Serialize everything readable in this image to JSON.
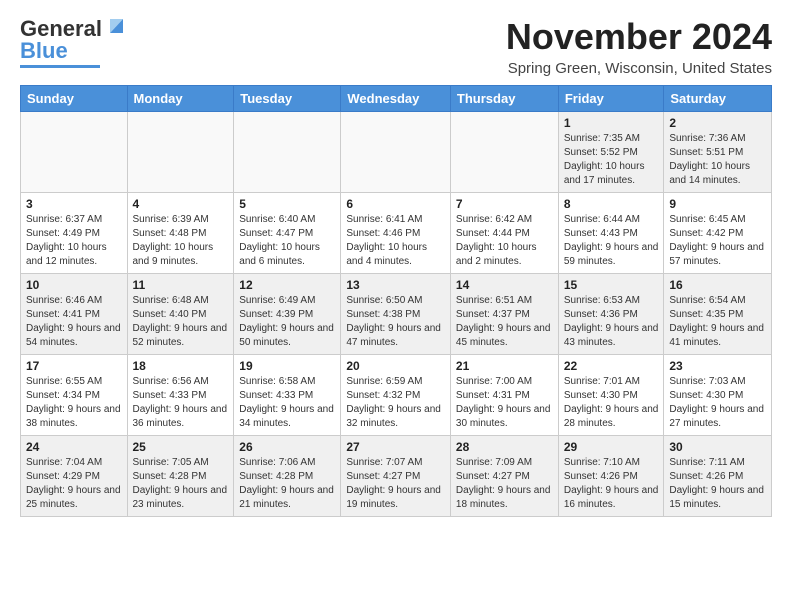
{
  "header": {
    "logo_line1": "General",
    "logo_line2": "Blue",
    "month_title": "November 2024",
    "location": "Spring Green, Wisconsin, United States"
  },
  "days_of_week": [
    "Sunday",
    "Monday",
    "Tuesday",
    "Wednesday",
    "Thursday",
    "Friday",
    "Saturday"
  ],
  "weeks": [
    [
      {
        "day": "",
        "info": ""
      },
      {
        "day": "",
        "info": ""
      },
      {
        "day": "",
        "info": ""
      },
      {
        "day": "",
        "info": ""
      },
      {
        "day": "",
        "info": ""
      },
      {
        "day": "1",
        "info": "Sunrise: 7:35 AM\nSunset: 5:52 PM\nDaylight: 10 hours and 17 minutes."
      },
      {
        "day": "2",
        "info": "Sunrise: 7:36 AM\nSunset: 5:51 PM\nDaylight: 10 hours and 14 minutes."
      }
    ],
    [
      {
        "day": "3",
        "info": "Sunrise: 6:37 AM\nSunset: 4:49 PM\nDaylight: 10 hours and 12 minutes."
      },
      {
        "day": "4",
        "info": "Sunrise: 6:39 AM\nSunset: 4:48 PM\nDaylight: 10 hours and 9 minutes."
      },
      {
        "day": "5",
        "info": "Sunrise: 6:40 AM\nSunset: 4:47 PM\nDaylight: 10 hours and 6 minutes."
      },
      {
        "day": "6",
        "info": "Sunrise: 6:41 AM\nSunset: 4:46 PM\nDaylight: 10 hours and 4 minutes."
      },
      {
        "day": "7",
        "info": "Sunrise: 6:42 AM\nSunset: 4:44 PM\nDaylight: 10 hours and 2 minutes."
      },
      {
        "day": "8",
        "info": "Sunrise: 6:44 AM\nSunset: 4:43 PM\nDaylight: 9 hours and 59 minutes."
      },
      {
        "day": "9",
        "info": "Sunrise: 6:45 AM\nSunset: 4:42 PM\nDaylight: 9 hours and 57 minutes."
      }
    ],
    [
      {
        "day": "10",
        "info": "Sunrise: 6:46 AM\nSunset: 4:41 PM\nDaylight: 9 hours and 54 minutes."
      },
      {
        "day": "11",
        "info": "Sunrise: 6:48 AM\nSunset: 4:40 PM\nDaylight: 9 hours and 52 minutes."
      },
      {
        "day": "12",
        "info": "Sunrise: 6:49 AM\nSunset: 4:39 PM\nDaylight: 9 hours and 50 minutes."
      },
      {
        "day": "13",
        "info": "Sunrise: 6:50 AM\nSunset: 4:38 PM\nDaylight: 9 hours and 47 minutes."
      },
      {
        "day": "14",
        "info": "Sunrise: 6:51 AM\nSunset: 4:37 PM\nDaylight: 9 hours and 45 minutes."
      },
      {
        "day": "15",
        "info": "Sunrise: 6:53 AM\nSunset: 4:36 PM\nDaylight: 9 hours and 43 minutes."
      },
      {
        "day": "16",
        "info": "Sunrise: 6:54 AM\nSunset: 4:35 PM\nDaylight: 9 hours and 41 minutes."
      }
    ],
    [
      {
        "day": "17",
        "info": "Sunrise: 6:55 AM\nSunset: 4:34 PM\nDaylight: 9 hours and 38 minutes."
      },
      {
        "day": "18",
        "info": "Sunrise: 6:56 AM\nSunset: 4:33 PM\nDaylight: 9 hours and 36 minutes."
      },
      {
        "day": "19",
        "info": "Sunrise: 6:58 AM\nSunset: 4:33 PM\nDaylight: 9 hours and 34 minutes."
      },
      {
        "day": "20",
        "info": "Sunrise: 6:59 AM\nSunset: 4:32 PM\nDaylight: 9 hours and 32 minutes."
      },
      {
        "day": "21",
        "info": "Sunrise: 7:00 AM\nSunset: 4:31 PM\nDaylight: 9 hours and 30 minutes."
      },
      {
        "day": "22",
        "info": "Sunrise: 7:01 AM\nSunset: 4:30 PM\nDaylight: 9 hours and 28 minutes."
      },
      {
        "day": "23",
        "info": "Sunrise: 7:03 AM\nSunset: 4:30 PM\nDaylight: 9 hours and 27 minutes."
      }
    ],
    [
      {
        "day": "24",
        "info": "Sunrise: 7:04 AM\nSunset: 4:29 PM\nDaylight: 9 hours and 25 minutes."
      },
      {
        "day": "25",
        "info": "Sunrise: 7:05 AM\nSunset: 4:28 PM\nDaylight: 9 hours and 23 minutes."
      },
      {
        "day": "26",
        "info": "Sunrise: 7:06 AM\nSunset: 4:28 PM\nDaylight: 9 hours and 21 minutes."
      },
      {
        "day": "27",
        "info": "Sunrise: 7:07 AM\nSunset: 4:27 PM\nDaylight: 9 hours and 19 minutes."
      },
      {
        "day": "28",
        "info": "Sunrise: 7:09 AM\nSunset: 4:27 PM\nDaylight: 9 hours and 18 minutes."
      },
      {
        "day": "29",
        "info": "Sunrise: 7:10 AM\nSunset: 4:26 PM\nDaylight: 9 hours and 16 minutes."
      },
      {
        "day": "30",
        "info": "Sunrise: 7:11 AM\nSunset: 4:26 PM\nDaylight: 9 hours and 15 minutes."
      }
    ]
  ]
}
